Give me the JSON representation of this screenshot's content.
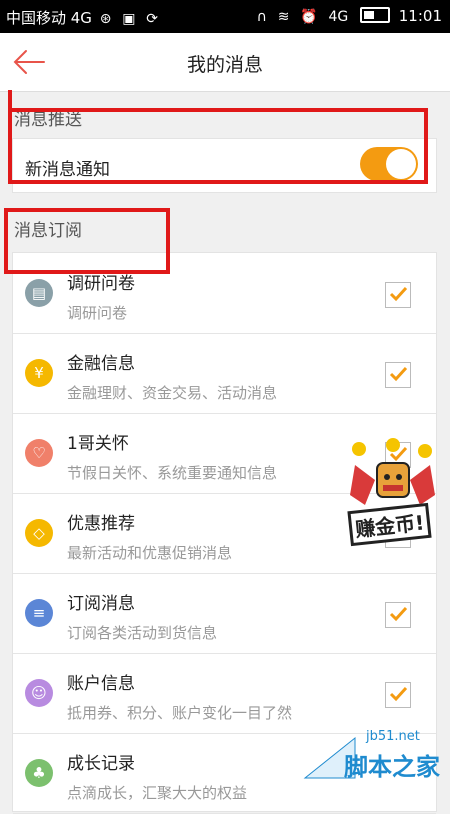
{
  "statusbar": {
    "carrier": "中国移动 4G",
    "signal": "4G",
    "time": "11:01"
  },
  "header": {
    "title": "我的消息"
  },
  "push_section": {
    "title": "消息推送",
    "new_message_label": "新消息通知",
    "new_message_enabled": true
  },
  "subscribe_section": {
    "title": "消息订阅",
    "items": [
      {
        "title": "调研问卷",
        "subtitle": "调研问卷",
        "icon": "clipboard-icon",
        "color": "#8aa0a8",
        "checked": true
      },
      {
        "title": "金融信息",
        "subtitle": "金融理财、资金交易、活动消息",
        "icon": "money-bag-icon",
        "color": "#f5b800",
        "checked": true
      },
      {
        "title": "1哥关怀",
        "subtitle": "节假日关怀、系统重要通知信息",
        "icon": "heart-icon",
        "color": "#f0806a",
        "checked": true
      },
      {
        "title": "优惠推荐",
        "subtitle": "最新活动和优惠促销消息",
        "icon": "tag-icon",
        "color": "#f5b800",
        "checked": false
      },
      {
        "title": "订阅消息",
        "subtitle": "订阅各类活动到货信息",
        "icon": "document-icon",
        "color": "#5b86d6",
        "checked": true
      },
      {
        "title": "账户信息",
        "subtitle": "抵用券、积分、账户变化一目了然",
        "icon": "person-icon",
        "color": "#b88be0",
        "checked": true
      },
      {
        "title": "成长记录",
        "subtitle": "点滴成长，汇聚大大的权益",
        "icon": "leaf-icon",
        "color": "#7cc06e",
        "checked": false
      }
    ]
  },
  "promo": {
    "text": "赚金币!"
  },
  "watermark": {
    "site": "jb51.net",
    "name": "脚本之家"
  },
  "colors": {
    "accent": "#f49b11",
    "highlight_box": "#e01919",
    "back_arrow": "#e8544a"
  }
}
